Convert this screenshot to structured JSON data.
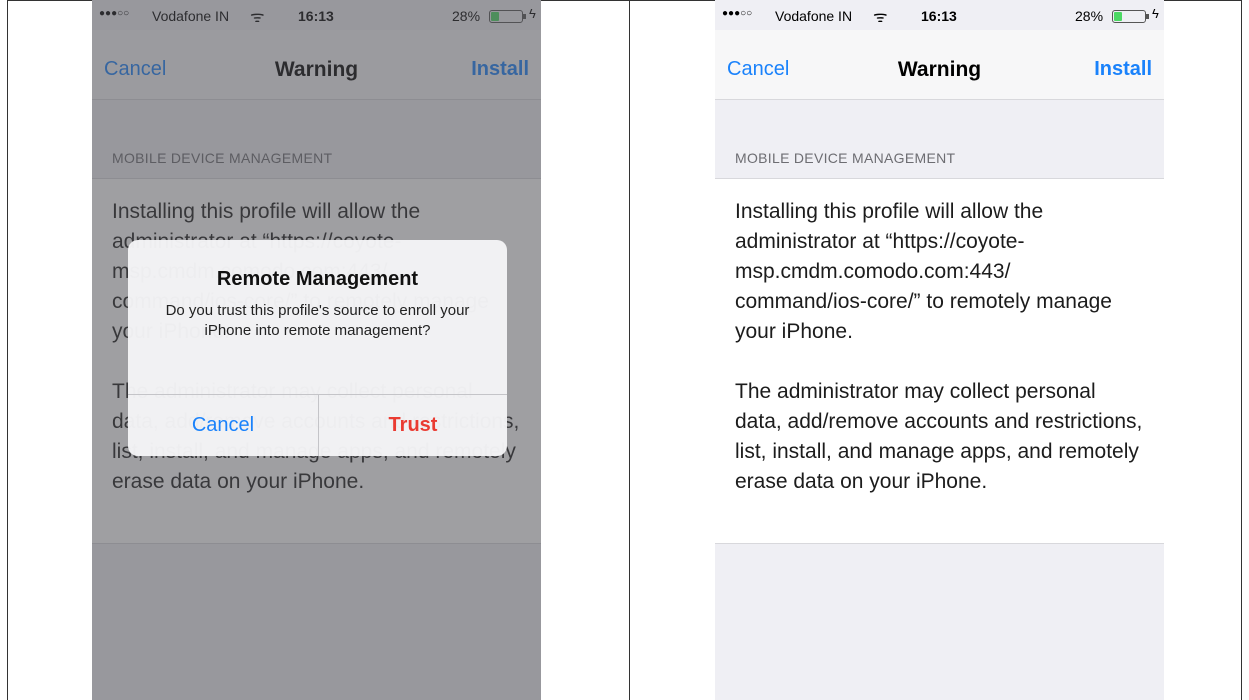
{
  "status_bar": {
    "signal": "●●●○○",
    "carrier": "Vodafone IN",
    "wifi_glyph": "ᯤ",
    "time": "16:13",
    "battery_percent": "28%",
    "battery_level": 0.28,
    "charging_glyph": "ϟ"
  },
  "navbar": {
    "cancel_label": "Cancel",
    "title": "Warning",
    "install_label": "Install"
  },
  "section": {
    "header": "MOBILE DEVICE MANAGEMENT"
  },
  "content": {
    "paragraph_1": "Installing this profile will allow the administrator at “https://coyote-msp.cmdm.comodo.com:443/ command/ios-core/” to remotely manage your iPhone.",
    "paragraph_2": "The administrator may collect personal data, add/remove accounts and restrictions, list, install, and manage apps, and remotely erase data on your iPhone."
  },
  "alert": {
    "title": "Remote Management",
    "message": "Do you trust this profile's source to enroll your iPhone into remote management?",
    "cancel_label": "Cancel",
    "trust_label": "Trust"
  },
  "colors": {
    "ios_blue": "#1a82fb",
    "destructive_red": "#ea3b32",
    "battery_green": "#4cd964",
    "background": "#efeff4"
  }
}
